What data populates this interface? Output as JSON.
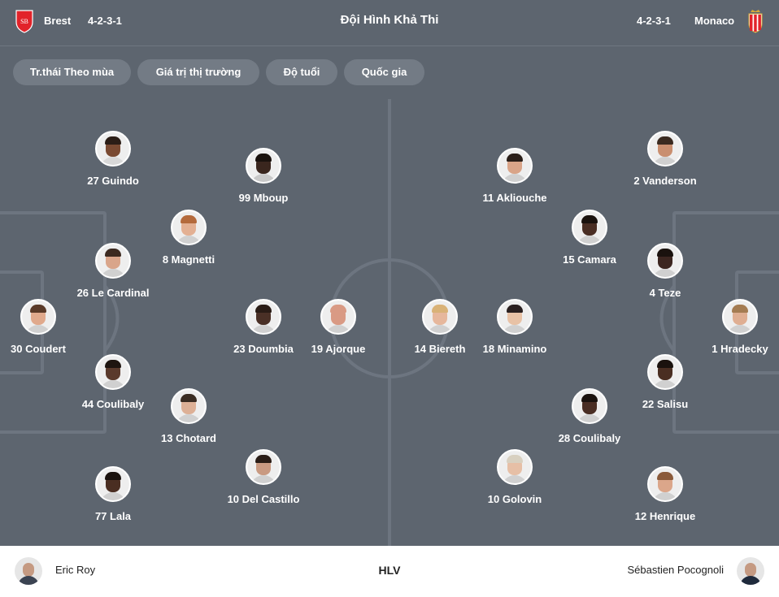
{
  "header": {
    "home": {
      "name": "Brest",
      "formation": "4-2-3-1",
      "logo_icon": "brest-crest-icon",
      "color": "#e2232a"
    },
    "away": {
      "name": "Monaco",
      "formation": "4-2-3-1",
      "logo_icon": "monaco-crest-icon",
      "color": "#e2232a"
    },
    "title": "Đội Hình Khả Thi"
  },
  "filters": [
    "Tr.thái Theo mùa",
    "Giá trị thị trường",
    "Độ tuổi",
    "Quốc gia"
  ],
  "home_players": [
    {
      "name": "27 Guindo"
    },
    {
      "name": "99 Mboup"
    },
    {
      "name": "8 Magnetti"
    },
    {
      "name": "26 Le Cardinal"
    },
    {
      "name": "30 Coudert"
    },
    {
      "name": "23 Doumbia"
    },
    {
      "name": "19 Ajorque"
    },
    {
      "name": "44 Coulibaly"
    },
    {
      "name": "13 Chotard"
    },
    {
      "name": "10 Del Castillo"
    },
    {
      "name": "77 Lala"
    }
  ],
  "away_players": [
    {
      "name": "11 Akliouche"
    },
    {
      "name": "2 Vanderson"
    },
    {
      "name": "15 Camara"
    },
    {
      "name": "4 Teze"
    },
    {
      "name": "14 Biereth"
    },
    {
      "name": "18 Minamino"
    },
    {
      "name": "1 Hradecky"
    },
    {
      "name": "22 Salisu"
    },
    {
      "name": "28 Coulibaly"
    },
    {
      "name": "10 Golovin"
    },
    {
      "name": "12 Henrique"
    }
  ],
  "footer": {
    "home_coach": "Eric Roy",
    "label": "HLV",
    "away_coach": "Sébastien Pocognoli"
  }
}
